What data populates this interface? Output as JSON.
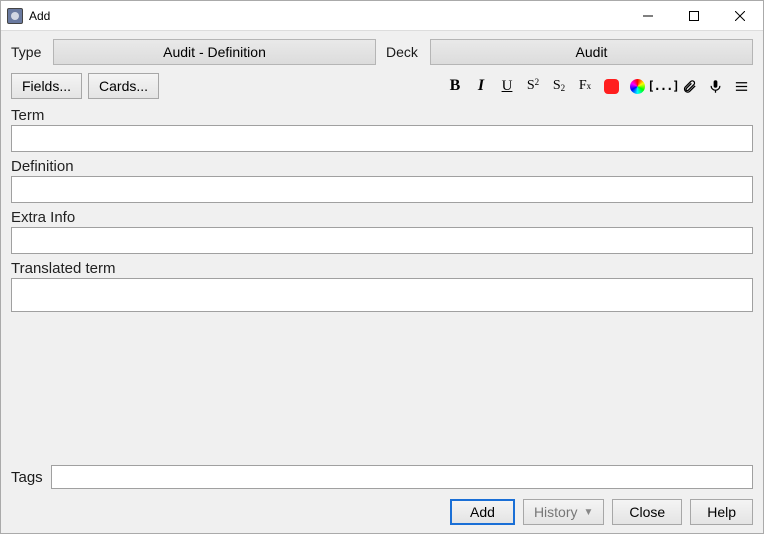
{
  "window": {
    "title": "Add"
  },
  "selectors": {
    "type_label": "Type",
    "type_value": "Audit - Definition",
    "deck_label": "Deck",
    "deck_value": "Audit"
  },
  "buttons": {
    "fields": "Fields...",
    "cards": "Cards...",
    "add": "Add",
    "history": "History",
    "close": "Close",
    "help": "Help"
  },
  "toolbar": {
    "bold": "B",
    "italic": "I",
    "underline": "U",
    "sup_base": "S",
    "sup_exp": "2",
    "sub_base": "S",
    "sub_exp": "2",
    "fx_base": "F",
    "fx_sub": "x",
    "cloze": "[...]"
  },
  "fields": [
    {
      "label": "Term",
      "value": ""
    },
    {
      "label": "Definition",
      "value": ""
    },
    {
      "label": "Extra Info",
      "value": ""
    },
    {
      "label": "Translated term",
      "value": ""
    }
  ],
  "tags": {
    "label": "Tags",
    "value": ""
  }
}
